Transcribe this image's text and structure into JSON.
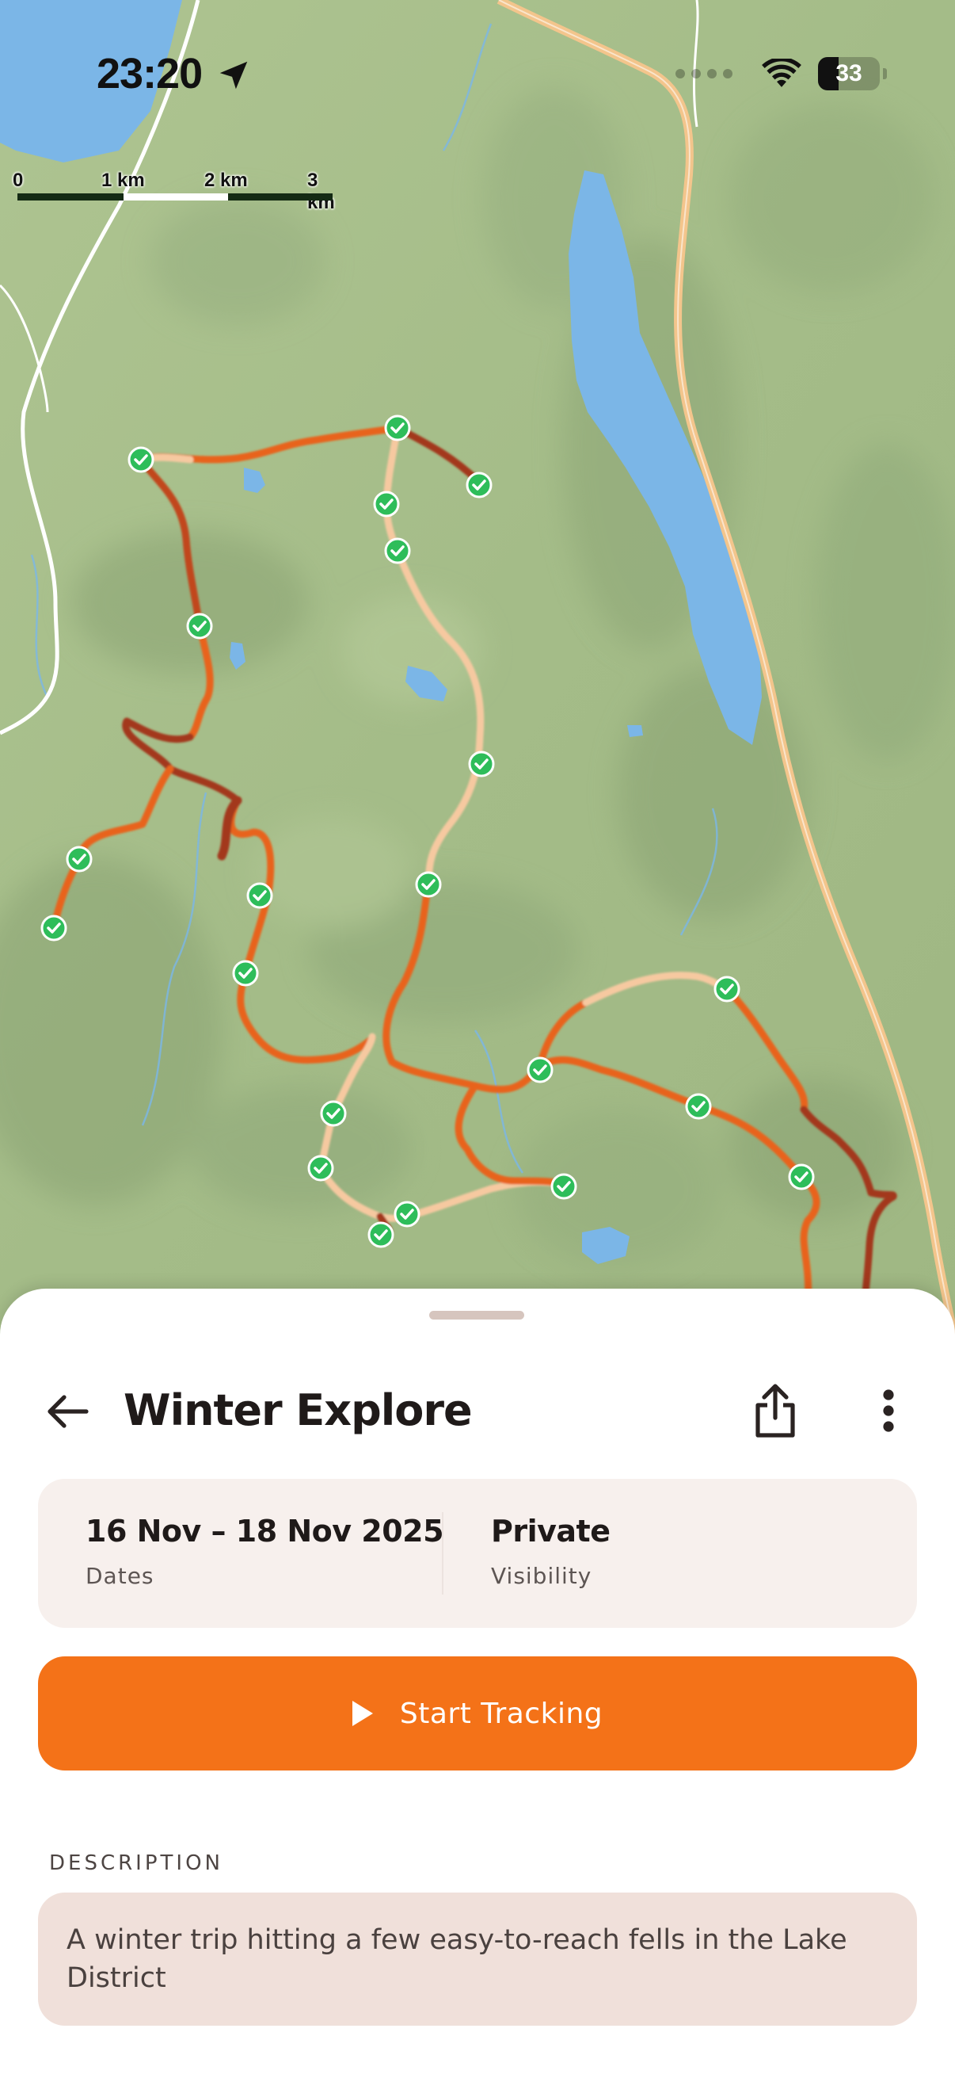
{
  "status_bar": {
    "time": "23:20",
    "battery_label": "33",
    "battery_level": 0.33,
    "icons": [
      "location-arrow-icon",
      "signal-dots-icon",
      "wifi-icon",
      "battery-icon"
    ]
  },
  "map": {
    "scale_labels": [
      "0",
      "1 km",
      "2 km",
      "3 km"
    ],
    "colors": {
      "land": "#a9c08e",
      "water": "#7bb6e7",
      "route_primary": "#e8641c",
      "route_dark": "#a3371b",
      "route_light": "#f6c9a0",
      "road": "#f3c58c",
      "checkpoint": "#2ebd5a"
    },
    "checkpoint_count": 22
  },
  "sheet": {
    "title": "Winter Explore",
    "icons": [
      "back-arrow-icon",
      "share-icon",
      "more-vertical-icon"
    ],
    "dates_value": "16 Nov – 18 Nov 2025",
    "dates_label": "Dates",
    "visibility_value": "Private",
    "visibility_label": "Visibility",
    "start_label": "Start Tracking",
    "description_heading": "DESCRIPTION",
    "description": "A winter trip hitting a few easy-to-reach fells in the Lake District",
    "colors": {
      "accent": "#f47218",
      "card": "#f7f0ed",
      "description_bg": "#f0e0da"
    }
  }
}
